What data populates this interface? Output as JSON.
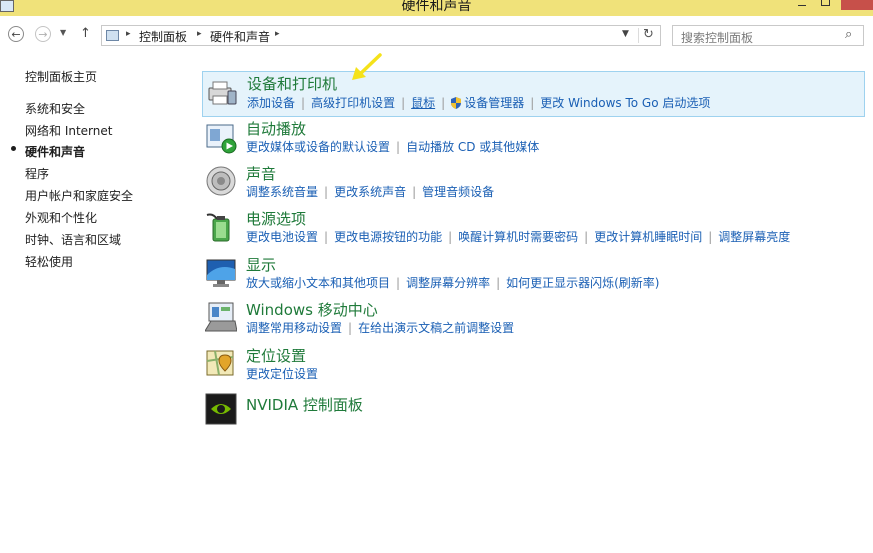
{
  "window": {
    "title": "硬件和声音"
  },
  "address_bar": {
    "breadcrumbs": [
      "控制面板",
      "硬件和声音"
    ],
    "search_placeholder": "搜索控制面板"
  },
  "left_nav": {
    "items": [
      {
        "label": "控制面板主页",
        "current": false
      },
      {
        "label": "系统和安全",
        "current": false
      },
      {
        "label": "网络和 Internet",
        "current": false
      },
      {
        "label": "硬件和声音",
        "current": true
      },
      {
        "label": "程序",
        "current": false
      },
      {
        "label": "用户帐户和家庭安全",
        "current": false
      },
      {
        "label": "外观和个性化",
        "current": false
      },
      {
        "label": "时钟、语言和区域",
        "current": false
      },
      {
        "label": "轻松使用",
        "current": false
      }
    ]
  },
  "categories": [
    {
      "title": "设备和打印机",
      "icon": "devices-printers-icon",
      "highlighted": true,
      "links": [
        "添加设备",
        "高级打印机设置",
        "鼠标",
        "设备管理器",
        "更改 Windows To Go 启动选项"
      ]
    },
    {
      "title": "自动播放",
      "icon": "autoplay-icon",
      "links": [
        "更改媒体或设备的默认设置",
        "自动播放 CD 或其他媒体"
      ]
    },
    {
      "title": "声音",
      "icon": "speaker-icon",
      "links": [
        "调整系统音量",
        "更改系统声音",
        "管理音频设备"
      ]
    },
    {
      "title": "电源选项",
      "icon": "power-options-icon",
      "links": [
        "更改电池设置",
        "更改电源按钮的功能",
        "唤醒计算机时需要密码",
        "更改计算机睡眠时间",
        "调整屏幕亮度"
      ]
    },
    {
      "title": "显示",
      "icon": "display-icon",
      "links": [
        "放大或缩小文本和其他项目",
        "调整屏幕分辨率",
        "如何更正显示器闪烁(刷新率)"
      ]
    },
    {
      "title": "Windows 移动中心",
      "icon": "mobility-center-icon",
      "links": [
        "调整常用移动设置",
        "在给出演示文稿之前调整设置"
      ]
    },
    {
      "title": "定位设置",
      "icon": "location-icon",
      "links": [
        "更改定位设置"
      ]
    },
    {
      "title": "NVIDIA 控制面板",
      "icon": "nvidia-icon",
      "links": []
    }
  ],
  "colors": {
    "link": "#1a5fb4",
    "heading": "#1f7a3a",
    "titlebar": "#f0e27a",
    "highlight": "#e5f3fb",
    "arrow": "#f5e21a"
  }
}
